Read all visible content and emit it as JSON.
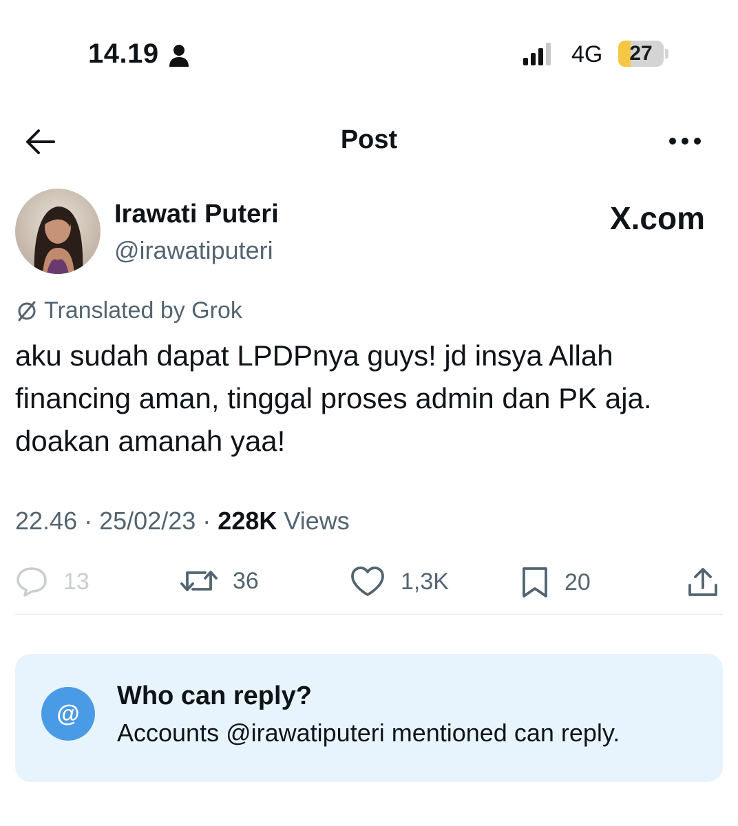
{
  "status_bar": {
    "time": "14.19",
    "network": "4G",
    "battery": "27",
    "battery_level": 0.27
  },
  "header": {
    "title": "Post"
  },
  "author": {
    "display_name": "Irawati Puteri",
    "handle": "@irawatiputeri"
  },
  "watermark": "X.com",
  "translation": {
    "label": "Translated by Grok"
  },
  "post": {
    "text": "aku sudah dapat LPDPnya guys! jd insya Allah financing aman, tinggal proses admin dan PK aja. doakan amanah yaa!",
    "time": "22.46",
    "date": "25/02/23",
    "views_count": "228K",
    "views_label": "Views"
  },
  "actions": {
    "replies": "13",
    "reposts": "36",
    "likes": "1,3K",
    "bookmarks": "20"
  },
  "reply_settings": {
    "icon": "@",
    "title": "Who can reply?",
    "description": "Accounts @irawatiputeri mentioned can reply."
  },
  "colors": {
    "text_primary": "#0f1419",
    "text_secondary": "#536471",
    "accent_blue": "#4a9be6",
    "card_bg": "#e8f4fd",
    "battery_yellow": "#f6c744"
  },
  "icons": {
    "person": "person-icon",
    "signal": "cellular-signal-icon",
    "back": "arrow-left-icon",
    "more": "ellipsis-icon",
    "translate": "translate-slash-icon",
    "reply": "speech-bubble-icon",
    "repost": "repost-icon",
    "like": "heart-icon",
    "bookmark": "bookmark-icon",
    "share": "share-icon"
  }
}
